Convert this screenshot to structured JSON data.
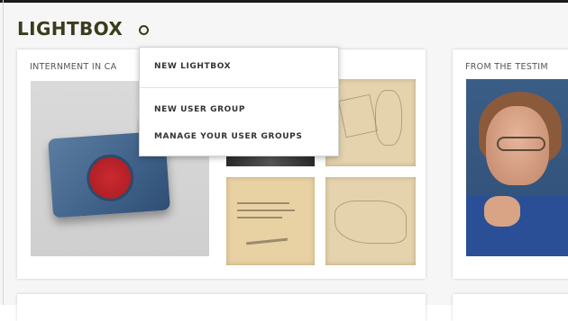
{
  "header": {
    "title": "LIGHTBOX"
  },
  "cards": [
    {
      "title": "INTERNMENT IN CA"
    },
    {
      "title": "FROM THE TESTIM"
    }
  ],
  "menu": {
    "items": [
      {
        "label": "NEW LIGHTBOX"
      },
      {
        "label": "NEW USER GROUP"
      },
      {
        "label": "MANAGE YOUR USER GROUPS"
      }
    ]
  },
  "colors": {
    "title": "#3b3c1c",
    "background": "#f6f6f6",
    "card": "#ffffff"
  },
  "icons": {
    "settings": "gear-icon"
  }
}
